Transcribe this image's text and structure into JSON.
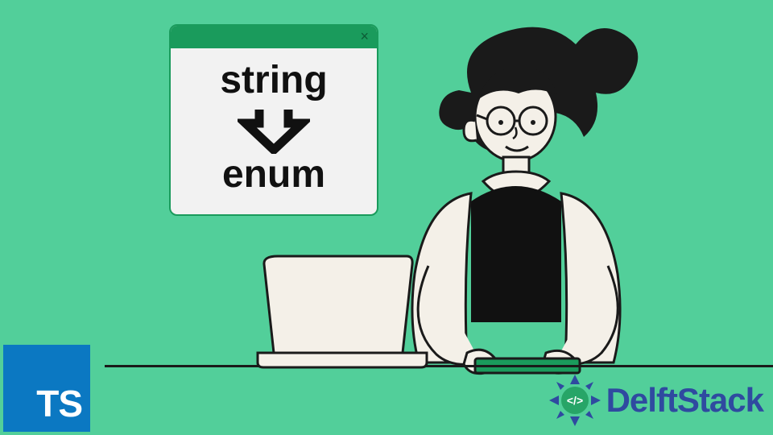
{
  "window": {
    "top_label": "string",
    "bottom_label": "enum",
    "close_glyph": "×"
  },
  "ts_badge": {
    "text": "TS"
  },
  "brand": {
    "name": "DelftStack"
  },
  "colors": {
    "bg": "#52cf9a",
    "green": "#1a9b5c",
    "panel": "#f2f2f2",
    "ink": "#111111",
    "ts_blue": "#0b78c2",
    "brand_blue": "#2f4aa0"
  }
}
